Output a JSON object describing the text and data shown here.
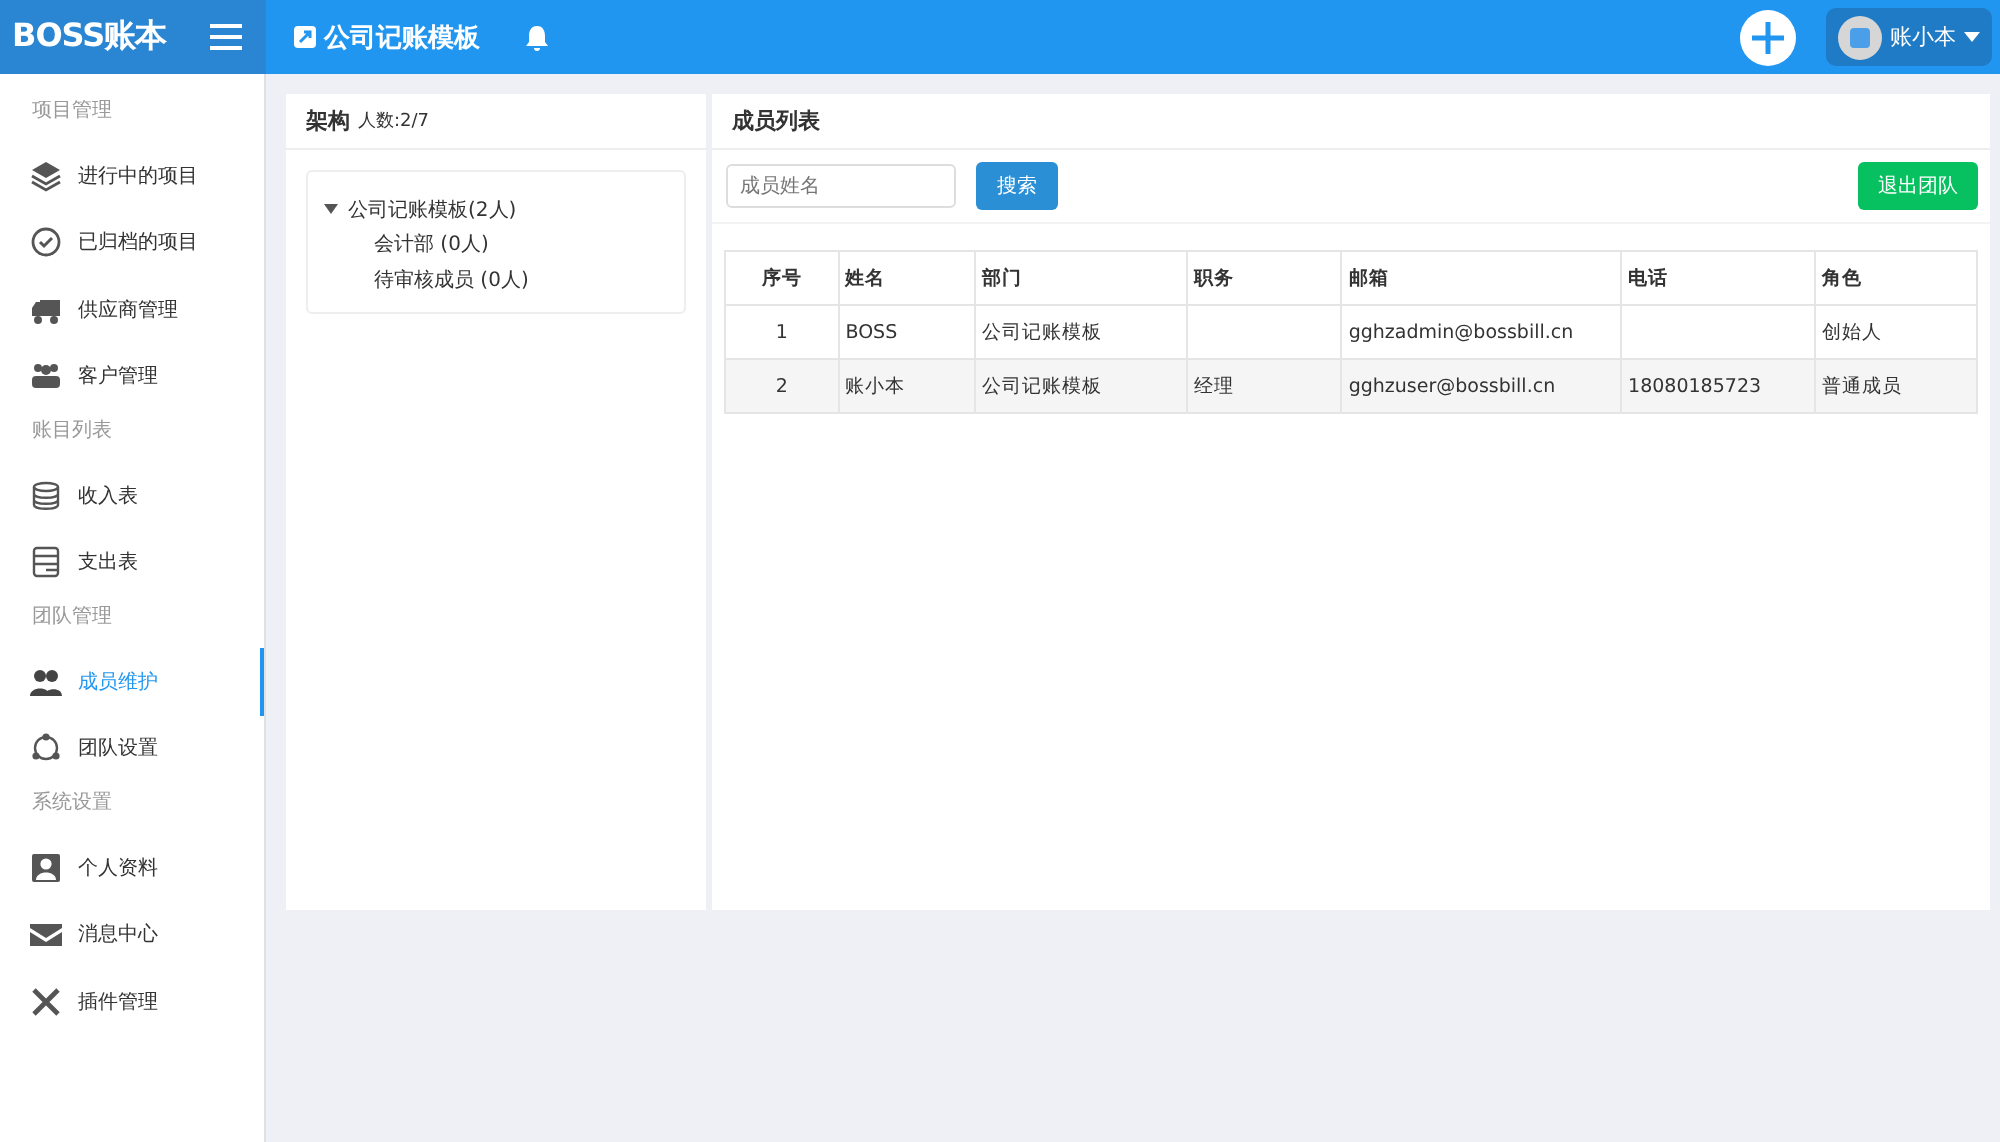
{
  "header": {
    "logo": "BOSS账本",
    "title": "公司记账模板",
    "user": "账小本"
  },
  "sidebar": [
    {
      "title": "项目管理",
      "items": [
        {
          "label": "进行中的项目",
          "selected": false
        },
        {
          "label": "已归档的项目",
          "selected": false
        },
        {
          "label": "供应商管理",
          "selected": false
        },
        {
          "label": "客户管理",
          "selected": false
        }
      ]
    },
    {
      "title": "账目列表",
      "items": [
        {
          "label": "收入表",
          "selected": false
        },
        {
          "label": "支出表",
          "selected": false
        }
      ]
    },
    {
      "title": "团队管理",
      "items": [
        {
          "label": "成员维护",
          "selected": true
        },
        {
          "label": "团队设置",
          "selected": false
        }
      ]
    },
    {
      "title": "系统设置",
      "items": [
        {
          "label": "个人资料",
          "selected": false
        },
        {
          "label": "消息中心",
          "selected": false
        },
        {
          "label": "插件管理",
          "selected": false
        }
      ]
    }
  ],
  "structure": {
    "title": "架构",
    "count": "人数:2/7",
    "tree": [
      {
        "label": "公司记账模板(2人)",
        "expanded": true,
        "children": [
          {
            "label": "会计部 (0人)"
          },
          {
            "label": "待审核成员 (0人)"
          }
        ]
      }
    ]
  },
  "members": {
    "title": "成员列表",
    "search": {
      "placeholder": "成员姓名"
    },
    "search_button": "搜索",
    "quit_button": "退出团队",
    "table": {
      "columns": [
        "序号",
        "姓名",
        "部门",
        "职务",
        "邮箱",
        "电话",
        "角色"
      ],
      "rows": [
        [
          "1",
          "BOSS",
          "公司记账模板",
          "",
          "gghzadmin@bossbill.cn",
          "",
          "创始人"
        ],
        [
          "2",
          "账小本",
          "公司记账模板",
          "经理",
          "gghzuser@bossbill.cn",
          "18080185723",
          "普通成员"
        ]
      ]
    }
  }
}
